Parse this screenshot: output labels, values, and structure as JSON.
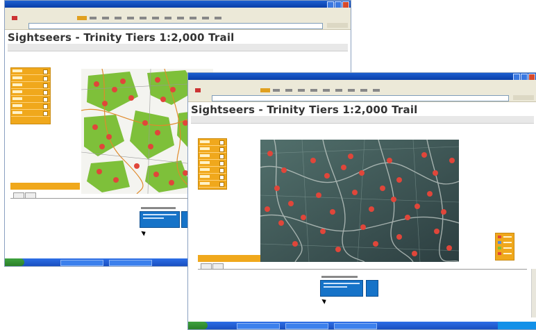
{
  "window1": {
    "title": "",
    "page_title": "Sightseers - Trinity Tiers 1:2,000 Trail"
  },
  "window2": {
    "title": "",
    "page_title": "Sightseers - Trinity Tiers 1:2,000 Trail"
  },
  "colors": {
    "xp_titlebar": "#0a3ea8",
    "panel_orange": "#f0a81c",
    "info_blue": "#1673c8",
    "marker_red": "#e0463a",
    "forest_green": "#7ec03a",
    "terrain_dark": "#3d5558"
  },
  "icons": [
    "mouse-cursor-icon",
    "minimize-icon",
    "maximize-icon",
    "close-icon",
    "start-button-icon"
  ]
}
